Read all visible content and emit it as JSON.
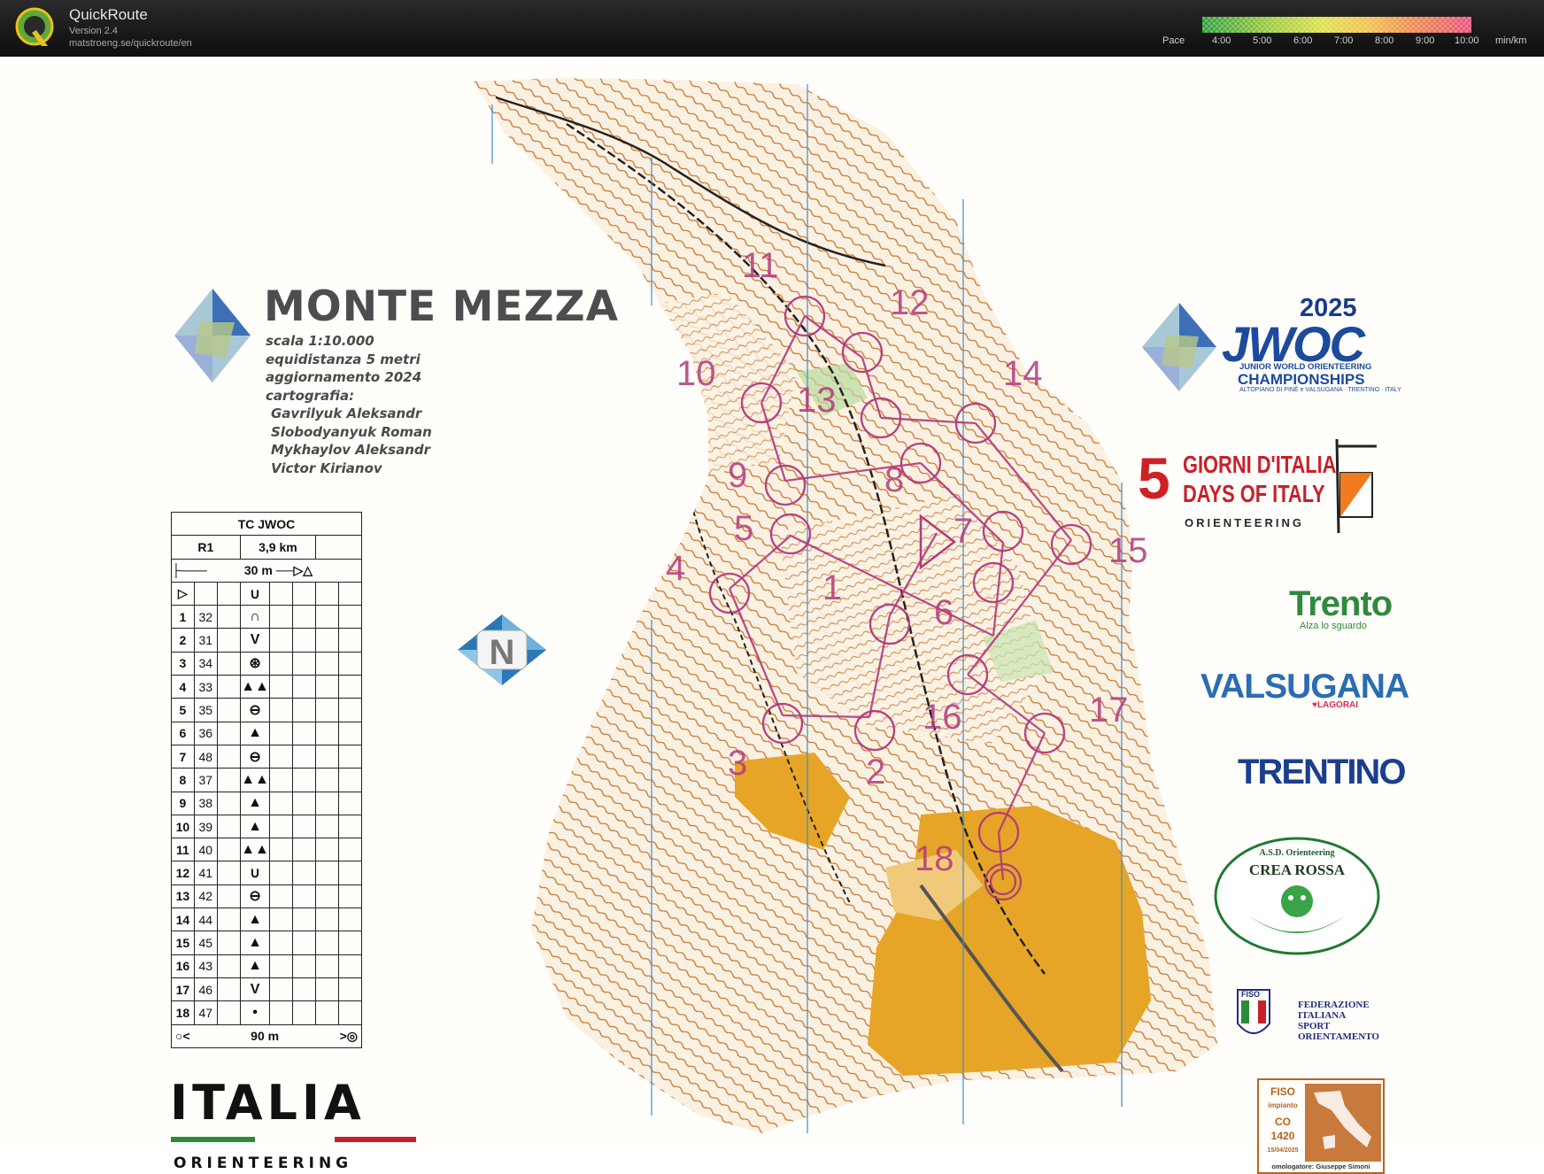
{
  "app": {
    "name": "QuickRoute",
    "version": "Version 2.4",
    "url": "matstroeng.se/quickroute/en"
  },
  "pace_scale": {
    "label": "Pace",
    "ticks": [
      "4:00",
      "5:00",
      "6:00",
      "7:00",
      "8:00",
      "9:00",
      "10:00"
    ],
    "unit": "min/km",
    "colors": [
      "#2e9e3f",
      "#7fbf3a",
      "#d7d74a",
      "#f0b84a",
      "#e8704a",
      "#e8507a"
    ]
  },
  "map": {
    "title": "MONTE MEZZA",
    "scale": "scala 1:10.000",
    "equidistance": "equidistanza 5 metri",
    "updated": "aggiornamento 2024",
    "cartography_label": "cartografia:",
    "cartographers": [
      "Gavrilyuk Aleksandr",
      "Slobodyanyuk Roman",
      "Mykhaylov Aleksandr",
      "Victor Kirianov"
    ],
    "course_color": "#b23a7c",
    "terrain_colors": {
      "contour": "#c9752e",
      "open_land": "#e6a526",
      "paper": "#fdf8ee"
    }
  },
  "control_description": {
    "event": "TC JWOC",
    "course": "R1",
    "length": "3,9 km",
    "start_tape": "30 m",
    "finish_tape": "90 m",
    "controls": [
      {
        "n": "1",
        "code": "32",
        "symbol": "∩"
      },
      {
        "n": "2",
        "code": "31",
        "symbol": "V"
      },
      {
        "n": "3",
        "code": "34",
        "symbol": "⊛"
      },
      {
        "n": "4",
        "code": "33",
        "symbol": "▲▲"
      },
      {
        "n": "5",
        "code": "35",
        "symbol": "⊖"
      },
      {
        "n": "6",
        "code": "36",
        "symbol": "▲"
      },
      {
        "n": "7",
        "code": "48",
        "symbol": "⊖"
      },
      {
        "n": "8",
        "code": "37",
        "symbol": "▲▲"
      },
      {
        "n": "9",
        "code": "38",
        "symbol": "▲"
      },
      {
        "n": "10",
        "code": "39",
        "symbol": "▲"
      },
      {
        "n": "11",
        "code": "40",
        "symbol": "▲▲"
      },
      {
        "n": "12",
        "code": "41",
        "symbol": "∪"
      },
      {
        "n": "13",
        "code": "42",
        "symbol": "⊖"
      },
      {
        "n": "14",
        "code": "44",
        "symbol": "▲"
      },
      {
        "n": "15",
        "code": "45",
        "symbol": "▲"
      },
      {
        "n": "16",
        "code": "43",
        "symbol": "▲"
      },
      {
        "n": "17",
        "code": "46",
        "symbol": "V"
      },
      {
        "n": "18",
        "code": "47",
        "symbol": "•"
      }
    ],
    "start_symbol": "▷",
    "start_feature": "∪"
  },
  "course_labels": [
    "1",
    "2",
    "3",
    "4",
    "5",
    "6",
    "7",
    "8",
    "9",
    "10",
    "11",
    "12",
    "13",
    "14",
    "15",
    "16",
    "17",
    "18"
  ],
  "north_arrow_letter": "N",
  "sponsors": {
    "jwoc_year": "2025",
    "jwoc_word": "JWOC",
    "jwoc_sub1": "JUNIOR WORLD ORIENTEERING",
    "jwoc_sub2": "CHAMPIONSHIPS",
    "jwoc_sub3": "ALTOPIANO DI PINÈ e VALSUGANA · TRENTINO · ITALY",
    "giorni_5": "5",
    "giorni_l1": "GIORNI D'ITALIA",
    "giorni_l2": "DAYS OF ITALY",
    "giorni_l3": "ORIENTEERING",
    "trento": "Trento",
    "trento_sub": "Alza lo sguardo",
    "valsugana": "VALSUGANA",
    "lagorai": "♥LAGORAI",
    "trentino": "TRENTINO",
    "crea_rossa_top": "A.S.D. Orienteering",
    "crea_rossa": "CREA ROSSA",
    "fiso_abbr": "FISO",
    "fiso_l1": "FEDERAZIONE",
    "fiso_l2": "ITALIANA",
    "fiso_l3": "SPORT",
    "fiso_l4": "ORIENTAMENTO",
    "impianto_fiso": "FISO",
    "impianto": "impianto",
    "impianto_code1": "CO",
    "impianto_code2": "1420",
    "impianto_date": "15/04/2025",
    "omologatore": "omologatore: Giuseppe Simoni"
  },
  "italia_logo": {
    "word": "ITALIA",
    "sub": "ORIENTEERING"
  }
}
